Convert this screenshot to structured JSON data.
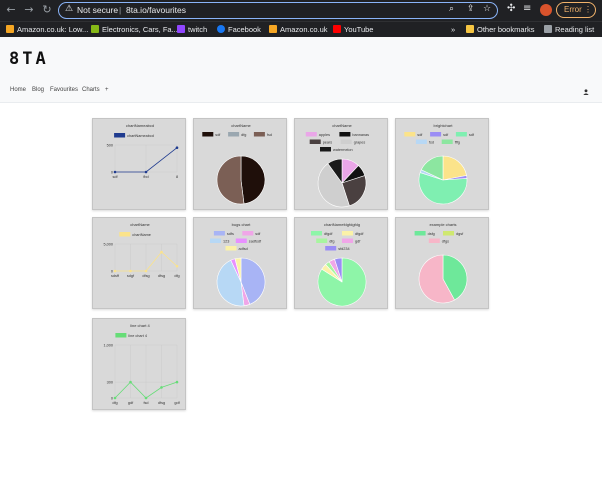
{
  "browser": {
    "url_warning": "Not secure",
    "url": "8ta.io/favourites",
    "profile_button": "Error",
    "bookmarks": [
      {
        "label": "Amazon.co.uk: Low...",
        "color": "#f5a623"
      },
      {
        "label": "Electronics, Cars, Fa...",
        "color": "#86b817"
      },
      {
        "label": "twitch",
        "color": "#9146ff"
      },
      {
        "label": "Facebook",
        "color": "#1877f2"
      },
      {
        "label": "Amazon.co.uk",
        "color": "#f5a623"
      },
      {
        "label": "YouTube",
        "color": "#ff0000"
      }
    ],
    "other_bookmarks": "Other bookmarks",
    "reading_list": "Reading list",
    "more": "»"
  },
  "site": {
    "logo": "8TA",
    "nav": [
      "Home",
      "Blog",
      "Favourites",
      "Charts",
      "+"
    ]
  },
  "chart_data": [
    {
      "type": "line",
      "title": "chartNameabcd",
      "categories": [
        "sdf",
        "fbd",
        "8"
      ],
      "series": [
        {
          "name": "chartNameabcd",
          "values": [
            0,
            0,
            450
          ],
          "color": "#1f3b8f"
        }
      ],
      "yticks": [
        "500",
        "0"
      ],
      "ylim": [
        0,
        500
      ]
    },
    {
      "type": "pie",
      "title": "chartName",
      "labels": [
        "sdf",
        "dfg",
        "fsd"
      ],
      "values": [
        48,
        0,
        52
      ],
      "colors": [
        "#1f0f0a",
        "#9aa7b0",
        "#7b5f55"
      ]
    },
    {
      "type": "pie",
      "title": "chartName",
      "labels": [
        "apples",
        "bannanas",
        "pears",
        "grapes",
        "watermelon"
      ],
      "values": [
        12,
        8,
        25,
        45,
        10
      ],
      "colors": [
        "#eaa6e8",
        "#111111",
        "#4a4040",
        "#cfcfcf",
        "#1a1a1a"
      ]
    },
    {
      "type": "pie",
      "title": "brightchart",
      "labels": [
        "sdf",
        "sdf",
        "sdf",
        "fsd",
        "fffg"
      ],
      "values": [
        22,
        2,
        56,
        2,
        18
      ],
      "colors": [
        "#fbe38a",
        "#9b8df5",
        "#7fefb1",
        "#b7d8f5",
        "#8ce6a0"
      ]
    },
    {
      "type": "line",
      "title": "chartName",
      "categories": [
        "sdsff",
        "sdgf",
        "dfsg",
        "dfsg",
        "dfg"
      ],
      "series": [
        {
          "name": "chartName",
          "values": [
            0,
            0,
            0,
            3500,
            900
          ],
          "color": "#fbe38a"
        }
      ],
      "yticks": [
        "5,000",
        "0"
      ],
      "ylim": [
        0,
        5000
      ]
    },
    {
      "type": "pie",
      "title": "bugs chart",
      "labels": [
        "sdfs",
        "sdf",
        "123",
        "sadfsdf",
        "adfsd"
      ],
      "values": [
        44,
        4,
        45,
        3,
        4
      ],
      "colors": [
        "#a8b4f5",
        "#f0a6e8",
        "#b7d8f5",
        "#e890ff",
        "#fbf2a8"
      ]
    },
    {
      "type": "pie",
      "title": "chartNamefdgfdgfdg",
      "labels": [
        "dfgdf",
        "dfgdf",
        "dfg",
        "gdf",
        "sfd234"
      ],
      "values": [
        84,
        4,
        3,
        4,
        5
      ],
      "colors": [
        "#8ef5a8",
        "#fbf2a8",
        "#a8f5a0",
        "#f0a6e8",
        "#9b8df5"
      ]
    },
    {
      "type": "pie",
      "title": "example charts",
      "labels": [
        "dsfg",
        "dgsf",
        "dfgs"
      ],
      "values": [
        42,
        0,
        58
      ],
      "colors": [
        "#6ee89a",
        "#cfe870",
        "#f7b6c8"
      ]
    },
    {
      "type": "line",
      "title": "line chart 4",
      "categories": [
        "dfg",
        "gdf",
        "fsd",
        "dfsg",
        "gdf"
      ],
      "series": [
        {
          "name": "line chart 4",
          "values": [
            0,
            300,
            0,
            200,
            300
          ],
          "color": "#66dd77"
        }
      ],
      "yticks": [
        "1,000",
        "300",
        "0"
      ],
      "ylim": [
        0,
        1000
      ]
    }
  ]
}
